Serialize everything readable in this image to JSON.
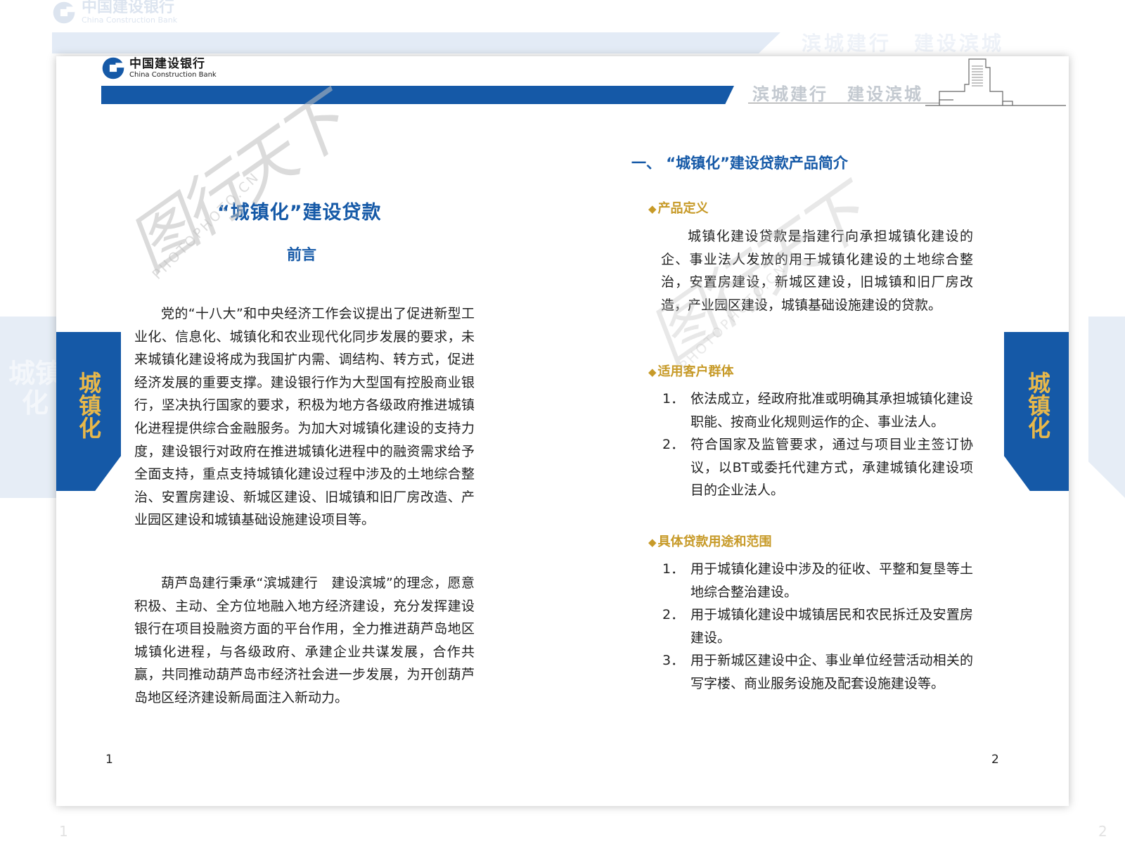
{
  "bank": {
    "name_cn": "中国建设银行",
    "name_en": "China Construction Bank"
  },
  "slogan": "滨城建行　建设滨城",
  "side_tab": "城镇化",
  "left_page": {
    "title": "“城镇化”建设贷款",
    "subtitle": "前言",
    "paragraphs": [
      "党的“十八大”和中央经济工作会议提出了促进新型工业化、信息化、城镇化和农业现代化同步发展的要求，未来城镇化建设将成为我国扩内需、调结构、转方式，促进经济发展的重要支撑。建设银行作为大型国有控股商业银行，坚决执行国家的要求，积极为地方各级政府推进城镇化进程提供综合金融服务。为加大对城镇化建设的支持力度，建设银行对政府在推进城镇化进程中的融资需求给予全面支持，重点支持城镇化建设过程中涉及的土地综合整治、安置房建设、新城区建设、旧城镇和旧厂房改造、产业园区建设和城镇基础设施建设项目等。",
      "葫芦岛建行秉承“滨城建行　建设滨城”的理念，愿意积极、主动、全方位地融入地方经济建设，充分发挥建设银行在项目投融资方面的平台作用，全力推进葫芦岛地区城镇化进程，与各级政府、承建企业共谋发展，合作共赢，共同推动葫芦岛市经济社会进一步发展，为开创葫芦岛地区经济建设新局面注入新动力。"
    ],
    "page_number": "1"
  },
  "right_page": {
    "section_title": "一、 “城镇化”建设贷款产品简介",
    "definition": {
      "heading": "产品定义",
      "text": "城镇化建设贷款是指建行向承担城镇化建设的企、事业法人发放的用于城镇化建设的土地综合整治，安置房建设，新城区建设，旧城镇和旧厂房改造，产业园区建设，城镇基础设施建设的贷款。"
    },
    "customers": {
      "heading": "适用客户群体",
      "items": [
        {
          "num": "1．",
          "text": "依法成立，经政府批准或明确其承担城镇化建设职能、按商业化规则运作的企、事业法人。"
        },
        {
          "num": "2．",
          "text": "符合国家及监管要求，通过与项目业主签订协议，以BT或委托代建方式，承建城镇化建设项目的企业法人。"
        }
      ]
    },
    "usage": {
      "heading": "具体贷款用途和范围",
      "items": [
        {
          "num": "1．",
          "text": "用于城镇化建设中涉及的征收、平整和复垦等土地综合整治建设。"
        },
        {
          "num": "2．",
          "text": "用于城镇化建设中城镇居民和农民拆迁及安置房建设。"
        },
        {
          "num": "3．",
          "text": "用于新城区建设中企、事业单位经营活动相关的写字楼、商业服务设施及配套设施建设等。"
        }
      ]
    },
    "page_number": "2"
  },
  "ghost": {
    "page_left": "1",
    "page_right": "2"
  },
  "watermark": {
    "logo_text": "图行天下",
    "site": "PHOTOPHOTO.CN"
  },
  "colors": {
    "brand_blue": "#1559a7",
    "gold": "#c79a28",
    "tab_text": "#e8b84a"
  }
}
